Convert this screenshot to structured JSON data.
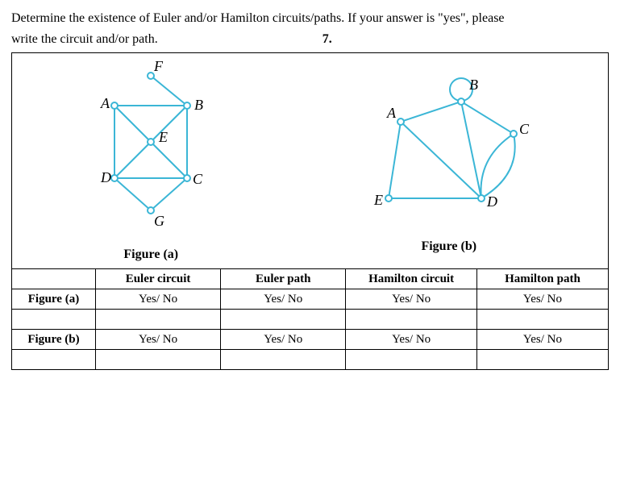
{
  "instructions_line1": "Determine the existence of Euler and/or Hamilton circuits/paths. If your answer is \"yes\", please",
  "instructions_line2": "write the circuit and/or path.",
  "problem_number": "7.",
  "figure_a": {
    "caption": "Figure (a)",
    "vertices": {
      "A": "A",
      "B": "B",
      "C": "C",
      "D": "D",
      "E": "E",
      "F": "F",
      "G": "G"
    }
  },
  "figure_b": {
    "caption": "Figure (b)",
    "vertices": {
      "A": "A",
      "B": "B",
      "C": "C",
      "D": "D",
      "E": "E"
    }
  },
  "table": {
    "headers": {
      "euler_circuit": "Euler circuit",
      "euler_path": "Euler path",
      "hamilton_circuit": "Hamilton circuit",
      "hamilton_path": "Hamilton path"
    },
    "row_a_label": "Figure (a)",
    "row_b_label": "Figure (b)",
    "yesno": "Yes/ No"
  }
}
